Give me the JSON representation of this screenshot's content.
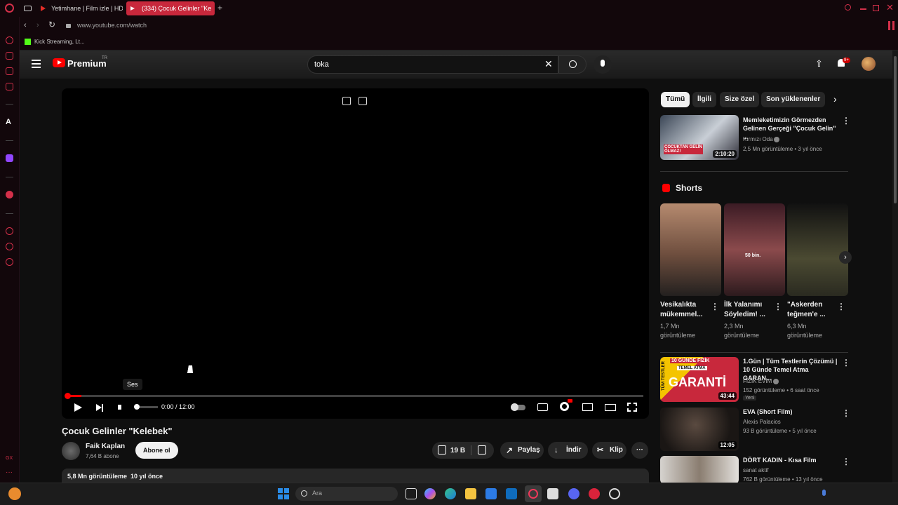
{
  "browser": {
    "tabs": [
      {
        "label": "Yetimhane | Film izle | HD"
      },
      {
        "label": "(334) Çocuk Gelinler \"Ke"
      }
    ],
    "new_tab": "+",
    "url": "www.youtube.com/watch",
    "bookmarks": [
      {
        "label": "Kick Streaming, Lt..."
      }
    ]
  },
  "youtube": {
    "logo_text": "Premium",
    "logo_badge": "TR",
    "search_value": "toka",
    "notification_count": "9+"
  },
  "player": {
    "tooltip": "Ses",
    "time": "0:00 / 12:00",
    "progress_fraction": 0.0
  },
  "video": {
    "title": "Çocuk Gelinler \"Kelebek\"",
    "channel": "Faik Kaplan",
    "subscribers": "7,64 B abone",
    "subscribe_label": "Abone ol",
    "likes": "19 B",
    "share_label": "Paylaş",
    "download_label": "İndir",
    "clip_label": "Klip",
    "description_meta": "5,8 Mn görüntüleme  10 yıl önce"
  },
  "chips": [
    "Tümü",
    "İlgili",
    "Size özel",
    "Son yüklenenler"
  ],
  "recommendations_top": [
    {
      "title": "Memleketimizin Görmezden Gelinen Gerçeği \"Çocuk Gelin\" ...",
      "channel": "Kırmızı Oda",
      "meta": "2,5 Mn görüntüleme • 3 yıl önce",
      "duration": "2:10:20",
      "thumb_text": "ÇOCUKTAN GELİN OLMAZ!"
    }
  ],
  "shorts": {
    "heading": "Shorts",
    "items": [
      {
        "title": "Vesikalıkta mükemmel...",
        "views": "1,7 Mn görüntüleme"
      },
      {
        "title": "İlk Yalanımı Söyledim! ...",
        "views": "2,3 Mn görüntüleme",
        "thumb_text": "50 bin."
      },
      {
        "title": "\"Askerden teğmen'e ...",
        "views": "6,3 Mn görüntüleme"
      }
    ]
  },
  "recommendations": [
    {
      "title": "1.Gün | Tüm Testlerin Çözümü | 10 Günde Temel Atma GARAN...",
      "channel": "FİZİK EVİM",
      "meta": "152 görüntüleme • 6 saat önce",
      "badge": "Yeni",
      "duration": "43:44",
      "thumb_text": "GARANTİ",
      "thumb_top": "10 GÜNDE FİZİK",
      "thumb_sub": "TEMEL ATMA",
      "thumb_side": "TÜM TESTLER"
    },
    {
      "title": "EVA (Short Film)",
      "channel": "Alexis Palacios",
      "meta": "93 B görüntüleme • 5 yıl önce",
      "duration": "12:05"
    },
    {
      "title": "DÖRT KADIN - Kısa Film",
      "channel": "sanat aktif",
      "meta": "762 B görüntüleme • 13 yıl önce"
    }
  ],
  "taskbar": {
    "search_placeholder": "Ara"
  },
  "colors": {
    "accent": "#c8283c",
    "yt_red": "#ff0000"
  }
}
